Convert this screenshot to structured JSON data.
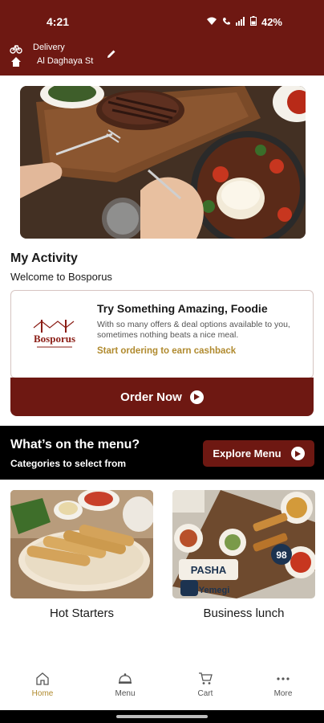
{
  "status_bar": {
    "time": "4:21",
    "battery": "42%"
  },
  "header": {
    "delivery_label": "Delivery",
    "address": "Al Daghaya St"
  },
  "activity": {
    "title": "My Activity",
    "subtitle": "Welcome to Bosporus"
  },
  "promo": {
    "logo_text": "Bosporus",
    "title": "Try Something Amazing, Foodie",
    "text": "With so many offers & deal options available to you, sometimes nothing beats a nice meal.",
    "link": "Start ordering to earn cashback"
  },
  "order_button": {
    "label": "Order Now"
  },
  "menu_section": {
    "title": "What’s on the menu?",
    "subtitle": "Categories to select from",
    "explore_label": "Explore Menu"
  },
  "categories": [
    {
      "label": "Hot Starters"
    },
    {
      "label": "Business lunch"
    }
  ],
  "category_art": {
    "banner_text": "PASHA",
    "banner_sub": "Yemegi",
    "price": "98"
  },
  "bottom_nav": {
    "items": [
      {
        "label": "Home",
        "icon": "home-icon"
      },
      {
        "label": "Menu",
        "icon": "cloche-icon"
      },
      {
        "label": "Cart",
        "icon": "cart-icon"
      },
      {
        "label": "More",
        "icon": "more-icon"
      }
    ],
    "active_color": "#b08a2e"
  },
  "colors": {
    "brand": "#6e1812",
    "accent": "#b08a2e"
  }
}
